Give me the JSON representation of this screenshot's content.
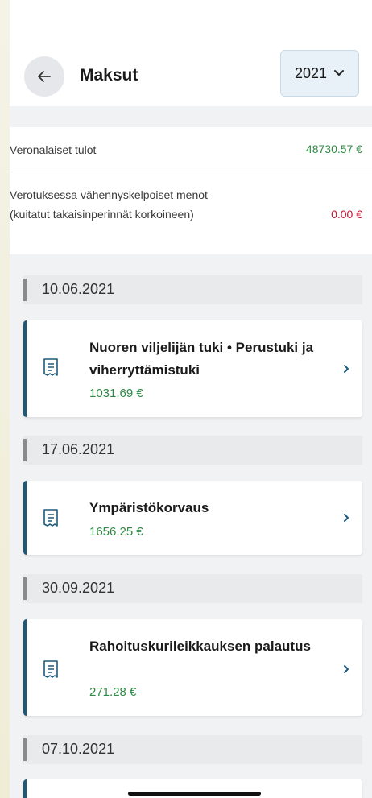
{
  "header": {
    "title": "Maksut",
    "year": "2021",
    "back_icon": "arrow-left-icon",
    "dropdown_icon": "chevron-down-icon"
  },
  "summary": {
    "taxable_income_label": "Veronalaiset tulot",
    "taxable_income_value": "48730.57 €",
    "deductible_label": "Verotuksessa vähennyskelpoiset menot (kuitatut takaisinperinnät korkoineen)",
    "deductible_value": "0.00 €"
  },
  "payments": [
    {
      "date": "10.06.2021",
      "title": "Nuoren viljelijän tuki • Perustuki ja viherryttämistuki",
      "amount": "1031.69 €"
    },
    {
      "date": "17.06.2021",
      "title": "Ympäristökorvaus",
      "amount": "1656.25 €"
    },
    {
      "date": "30.09.2021",
      "title": "Rahoituskurileikkauksen palautus",
      "amount": "271.28 €"
    },
    {
      "date": "07.10.2021"
    }
  ],
  "colors": {
    "positive": "#2e8a44",
    "negative": "#c8102e",
    "accent": "#1d5a7a"
  }
}
